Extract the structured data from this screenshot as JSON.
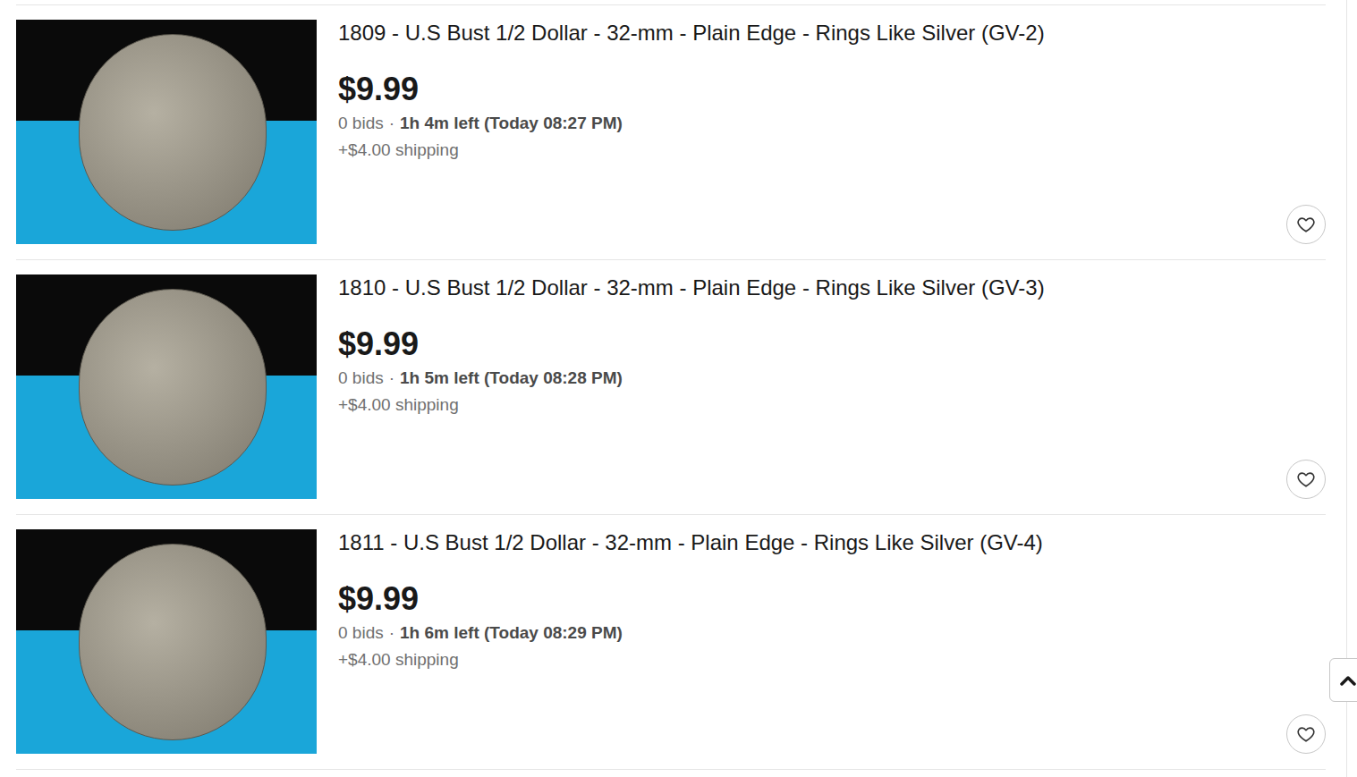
{
  "listings": [
    {
      "title": "1809 - U.S Bust 1/2 Dollar - 32-mm - Plain Edge - Rings Like Silver (GV-2)",
      "price": "$9.99",
      "bids": "0 bids",
      "separator": "·",
      "time_left": "1h 4m left (Today 08:27 PM)",
      "shipping": "+$4.00 shipping",
      "watched": false
    },
    {
      "title": "1810 - U.S Bust 1/2 Dollar - 32-mm - Plain Edge - Rings Like Silver (GV-3)",
      "price": "$9.99",
      "bids": "0 bids",
      "separator": "·",
      "time_left": "1h 5m left (Today 08:28 PM)",
      "shipping": "+$4.00 shipping",
      "watched": false
    },
    {
      "title": "1811 - U.S Bust 1/2 Dollar - 32-mm - Plain Edge - Rings Like Silver (GV-4)",
      "price": "$9.99",
      "bids": "0 bids",
      "separator": "·",
      "time_left": "1h 6m left (Today 08:29 PM)",
      "shipping": "+$4.00 shipping",
      "watched": false
    }
  ]
}
